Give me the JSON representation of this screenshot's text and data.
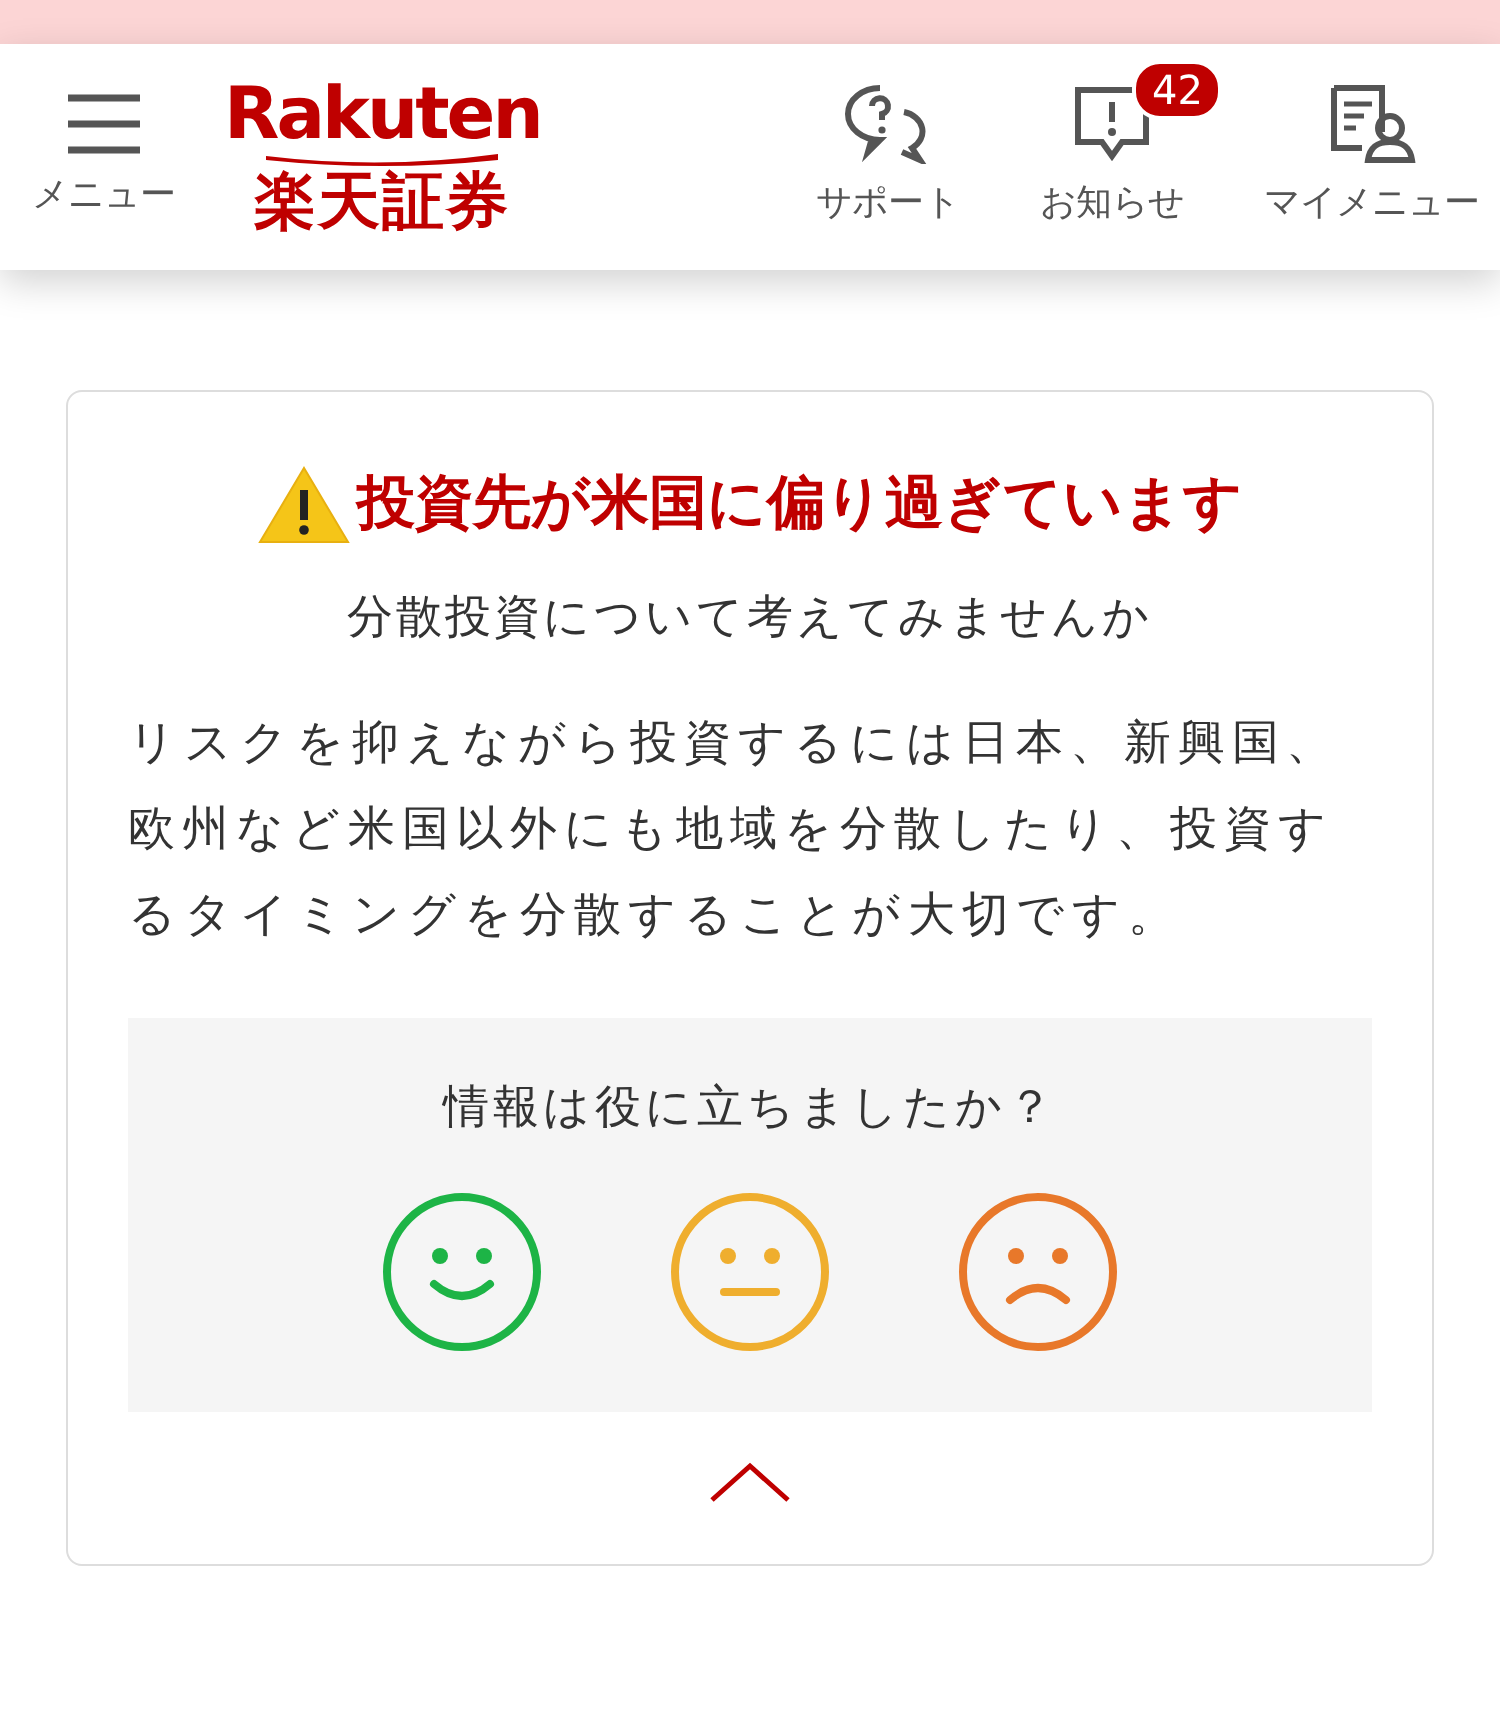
{
  "header": {
    "menu_label": "メニュー",
    "logo": {
      "wordmark": "Rakuten",
      "name": "楽天証券"
    },
    "actions": [
      {
        "kind": "support",
        "label": "サポート"
      },
      {
        "kind": "notice",
        "label": "お知らせ",
        "badge": "42"
      },
      {
        "kind": "mymenu",
        "label": "マイメニュー"
      }
    ]
  },
  "alert": {
    "title": "投資先が米国に偏り過ぎています",
    "subtitle": "分散投資について考えてみませんか",
    "body": "リスクを抑えながら投資するには日本、新興国、欧州など米国以外にも地域を分散したり、投資するタイミングを分散することが大切です。"
  },
  "feedback": {
    "question": "情報は役に立ちましたか？",
    "options": [
      {
        "kind": "good",
        "color": "#1db446",
        "selected": false
      },
      {
        "kind": "neutral",
        "color": "#efae2e",
        "selected": false
      },
      {
        "kind": "bad",
        "color": "#e8782a",
        "selected": false
      }
    ]
  },
  "collapse": {
    "expanded": true
  }
}
